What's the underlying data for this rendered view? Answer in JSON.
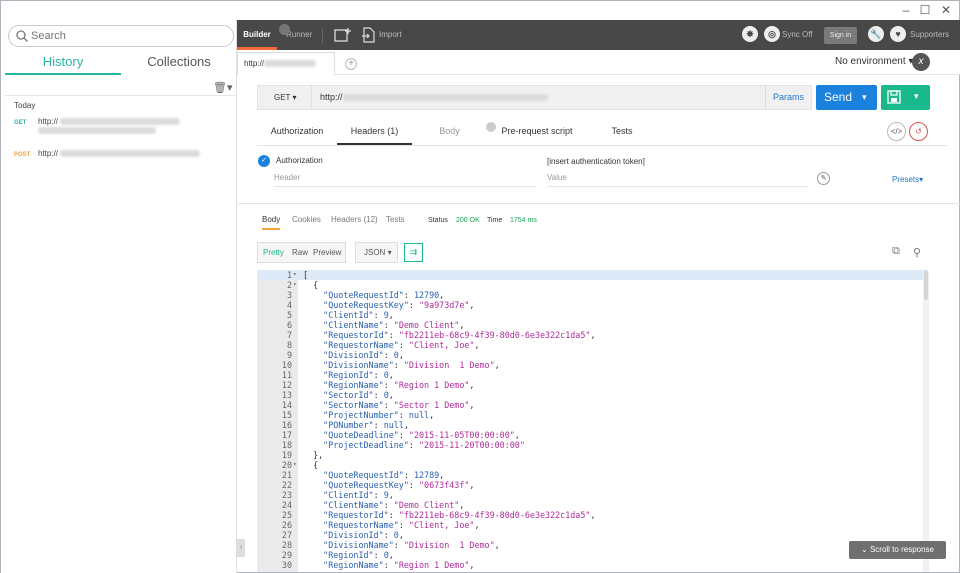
{
  "window": {
    "minimize": "–",
    "maximize": "☐",
    "close": "✕"
  },
  "sidebar": {
    "search_placeholder": "Search",
    "tabs": [
      "History",
      "Collections"
    ],
    "group_label": "Today",
    "history": [
      {
        "method": "GET",
        "method_color": "#26b5a3",
        "url_prefix": "http://"
      },
      {
        "method": "POST",
        "method_color": "#f2a33a",
        "url_prefix": "http://"
      }
    ]
  },
  "topbar": {
    "builder": "Builder",
    "runner": "Runner",
    "import": "Import",
    "sync": "Sync Off",
    "signin": "Sign in",
    "supporters": "Supporters",
    "accent": "#f26b3a"
  },
  "request_tab": {
    "label": "http://"
  },
  "environment": {
    "label": "No environment"
  },
  "request": {
    "method": "GET",
    "url_prefix": "http://",
    "params": "Params",
    "send": "Send"
  },
  "request_tabs": {
    "authorization": "Authorization",
    "headers": "Headers (1)",
    "body": "Body",
    "prerequest": "Pre-request script",
    "tests": "Tests"
  },
  "headers": {
    "key": "Authorization",
    "value": "[insert authentication token]",
    "key_placeholder": "Header",
    "value_placeholder": "Value",
    "presets": "Presets"
  },
  "response": {
    "tabs": [
      "Body",
      "Cookies",
      "Headers (12)",
      "Tests"
    ],
    "status_label": "Status",
    "status_value": "200 OK",
    "time_label": "Time",
    "time_value": "1754 ms",
    "format": [
      "Pretty",
      "Raw",
      "Preview"
    ],
    "language": "JSON",
    "scroll_to_response": "Scroll to response"
  },
  "code_lines": [
    {
      "n": "1",
      "fold": "▾",
      "indent": "",
      "text": "["
    },
    {
      "n": "2",
      "fold": "▾",
      "indent": "  ",
      "text": "{"
    },
    {
      "n": "3",
      "indent": "    ",
      "key": "\"QuoteRequestId\"",
      "val": "12790",
      "vt": "n",
      "comma": ","
    },
    {
      "n": "4",
      "indent": "    ",
      "key": "\"QuoteRequestKey\"",
      "val": "\"9a973d7e\"",
      "vt": "s",
      "comma": ","
    },
    {
      "n": "5",
      "indent": "    ",
      "key": "\"ClientId\"",
      "val": "9",
      "vt": "n",
      "comma": ","
    },
    {
      "n": "6",
      "indent": "    ",
      "key": "\"ClientName\"",
      "val": "\"Demo Client\"",
      "vt": "s",
      "comma": ","
    },
    {
      "n": "7",
      "indent": "    ",
      "key": "\"RequestorId\"",
      "val": "\"fb2211eb-68c9-4f39-80d0-6e3e322c1da5\"",
      "vt": "s",
      "comma": ","
    },
    {
      "n": "8",
      "indent": "    ",
      "key": "\"RequestorName\"",
      "val": "\"Client, Joe\"",
      "vt": "s",
      "comma": ","
    },
    {
      "n": "9",
      "indent": "    ",
      "key": "\"DivisionId\"",
      "val": "0",
      "vt": "n",
      "comma": ","
    },
    {
      "n": "10",
      "indent": "    ",
      "key": "\"DivisionName\"",
      "val": "\"Division  1 Demo\"",
      "vt": "s",
      "comma": ","
    },
    {
      "n": "11",
      "indent": "    ",
      "key": "\"RegionId\"",
      "val": "0",
      "vt": "n",
      "comma": ","
    },
    {
      "n": "12",
      "indent": "    ",
      "key": "\"RegionName\"",
      "val": "\"Region 1 Demo\"",
      "vt": "s",
      "comma": ","
    },
    {
      "n": "13",
      "indent": "    ",
      "key": "\"SectorId\"",
      "val": "0",
      "vt": "n",
      "comma": ","
    },
    {
      "n": "14",
      "indent": "    ",
      "key": "\"SectorName\"",
      "val": "\"Sector 1 Demo\"",
      "vt": "s",
      "comma": ","
    },
    {
      "n": "15",
      "indent": "    ",
      "key": "\"ProjectNumber\"",
      "val": "null",
      "vt": "n",
      "comma": ","
    },
    {
      "n": "16",
      "indent": "    ",
      "key": "\"PONumber\"",
      "val": "null",
      "vt": "n",
      "comma": ","
    },
    {
      "n": "17",
      "indent": "    ",
      "key": "\"QuoteDeadline\"",
      "val": "\"2015-11-05T00:00:00\"",
      "vt": "s",
      "comma": ","
    },
    {
      "n": "18",
      "indent": "    ",
      "key": "\"ProjectDeadline\"",
      "val": "\"2015-11-20T00:00:00\"",
      "vt": "s",
      "comma": ""
    },
    {
      "n": "19",
      "indent": "  ",
      "text": "},"
    },
    {
      "n": "20",
      "fold": "▾",
      "indent": "  ",
      "text": "{"
    },
    {
      "n": "21",
      "indent": "    ",
      "key": "\"QuoteRequestId\"",
      "val": "12789",
      "vt": "n",
      "comma": ","
    },
    {
      "n": "22",
      "indent": "    ",
      "key": "\"QuoteRequestKey\"",
      "val": "\"0673f43f\"",
      "vt": "s",
      "comma": ","
    },
    {
      "n": "23",
      "indent": "    ",
      "key": "\"ClientId\"",
      "val": "9",
      "vt": "n",
      "comma": ","
    },
    {
      "n": "24",
      "indent": "    ",
      "key": "\"ClientName\"",
      "val": "\"Demo Client\"",
      "vt": "s",
      "comma": ","
    },
    {
      "n": "25",
      "indent": "    ",
      "key": "\"RequestorId\"",
      "val": "\"fb2211eb-68c9-4f39-80d0-6e3e322c1da5\"",
      "vt": "s",
      "comma": ","
    },
    {
      "n": "26",
      "indent": "    ",
      "key": "\"RequestorName\"",
      "val": "\"Client, Joe\"",
      "vt": "s",
      "comma": ","
    },
    {
      "n": "27",
      "indent": "    ",
      "key": "\"DivisionId\"",
      "val": "0",
      "vt": "n",
      "comma": ","
    },
    {
      "n": "28",
      "indent": "    ",
      "key": "\"DivisionName\"",
      "val": "\"Division  1 Demo\"",
      "vt": "s",
      "comma": ","
    },
    {
      "n": "29",
      "indent": "    ",
      "key": "\"RegionId\"",
      "val": "0",
      "vt": "n",
      "comma": ","
    },
    {
      "n": "30",
      "indent": "    ",
      "key": "\"RegionName\"",
      "val": "\"Region 1 Demo\"",
      "vt": "s",
      "comma": ","
    }
  ]
}
